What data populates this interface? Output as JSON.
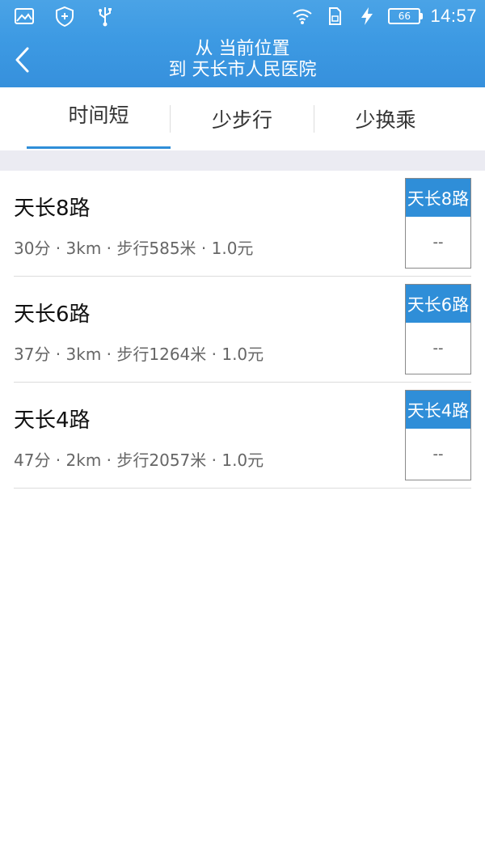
{
  "status_bar": {
    "icons_left": [
      "image-icon",
      "shield-icon",
      "usb-icon"
    ],
    "icons_right": [
      "wifi-icon",
      "sim-icon",
      "charging-icon"
    ],
    "battery": "66",
    "time": "14:57"
  },
  "header": {
    "from": "从 当前位置",
    "to": "到 天长市人民医院",
    "accent": "#3d9ae3"
  },
  "tabs": [
    {
      "label": "时间短",
      "active": true
    },
    {
      "label": "少步行",
      "active": false
    },
    {
      "label": "少换乘",
      "active": false
    }
  ],
  "routes": [
    {
      "name": "天长8路",
      "meta": "30分 · 3km · 步行585米 · 1.0元",
      "badge": "天长8路",
      "badge_sub": "--"
    },
    {
      "name": "天长6路",
      "meta": "37分 · 3km · 步行1264米 · 1.0元",
      "badge": "天长6路",
      "badge_sub": "--"
    },
    {
      "name": "天长4路",
      "meta": "47分 · 2km · 步行2057米 · 1.0元",
      "badge": "天长4路",
      "badge_sub": "--"
    }
  ]
}
